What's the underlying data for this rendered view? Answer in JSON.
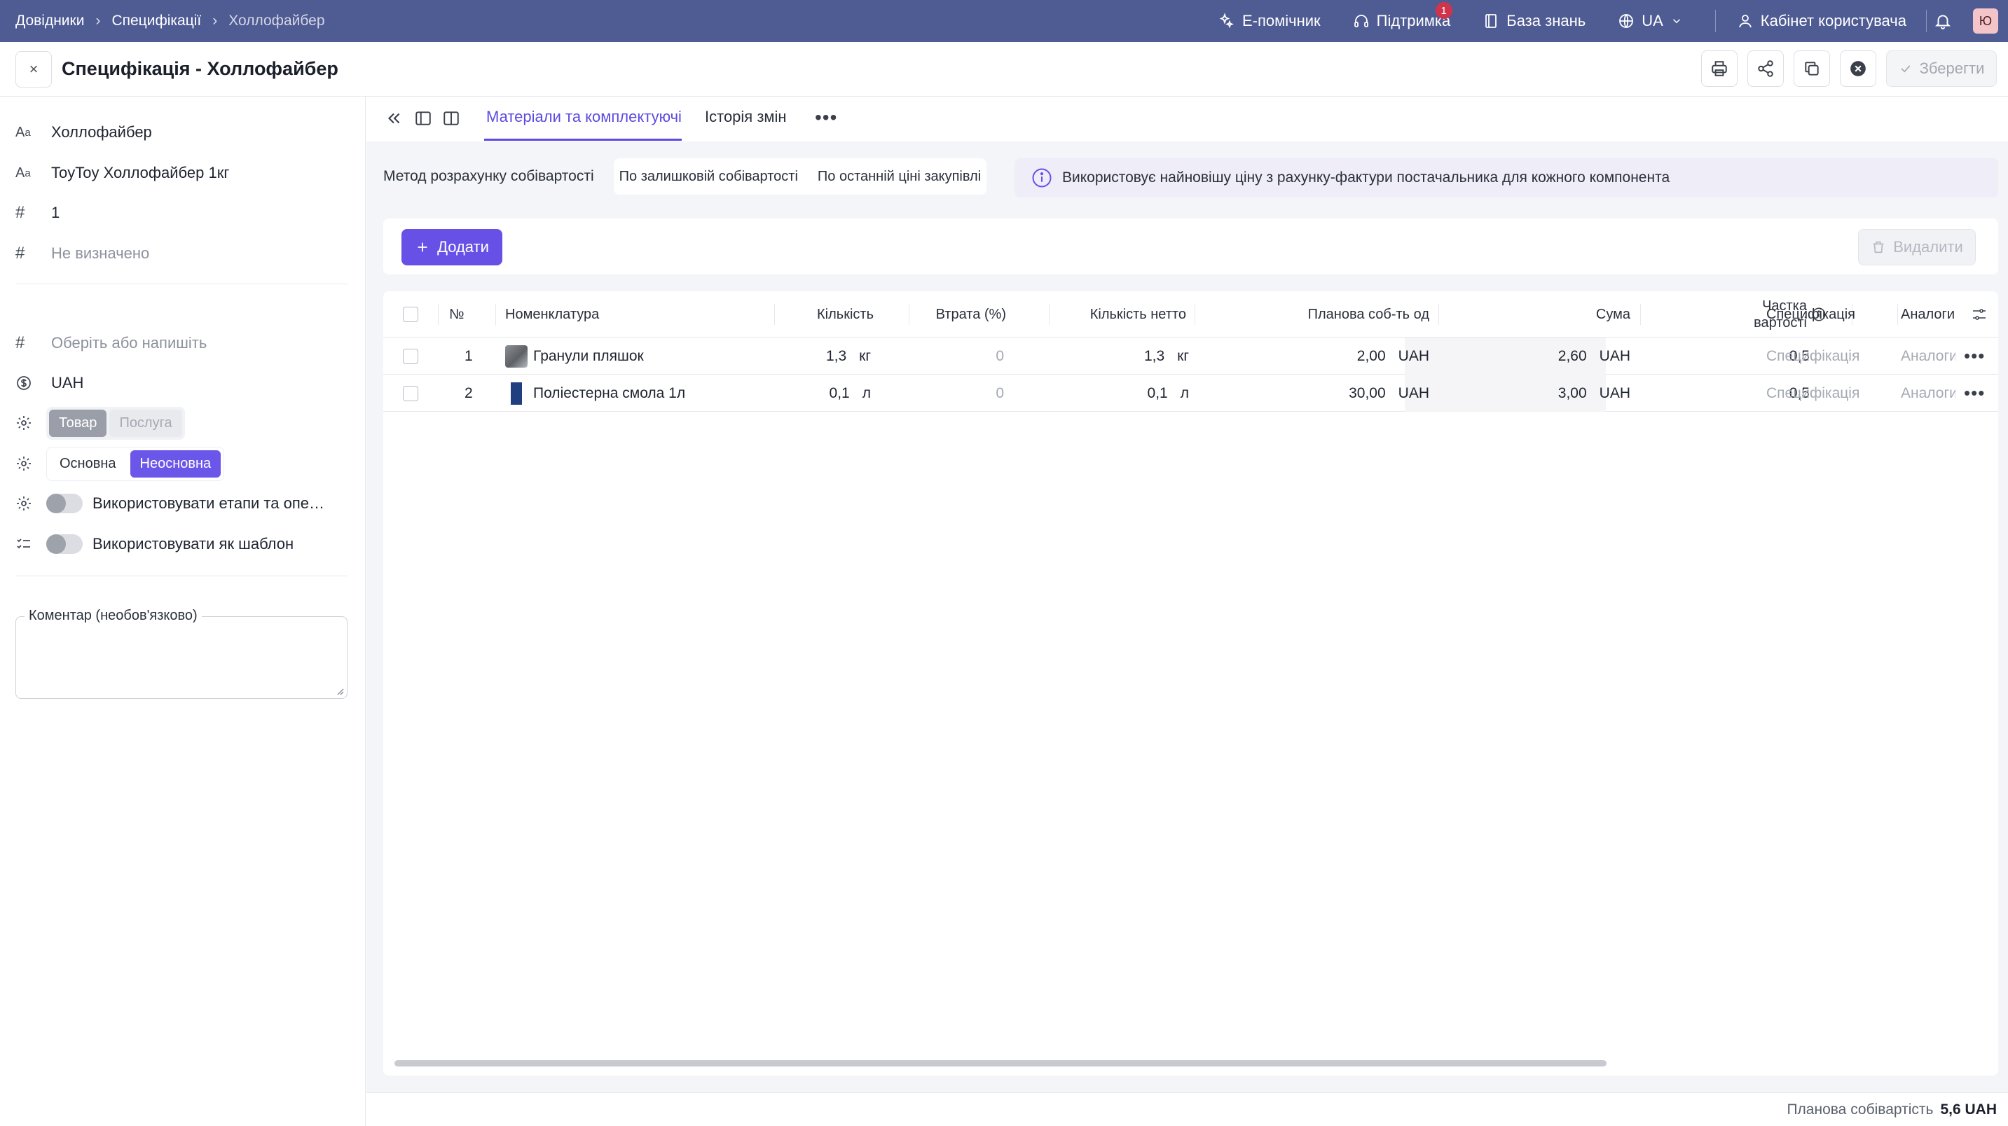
{
  "topbar": {
    "breadcrumbs": [
      "Довідники",
      "Специфікації",
      "Холлофайбер"
    ],
    "links": {
      "assistant": "E-помічник",
      "support": "Підтримка",
      "support_badge": "1",
      "knowledge": "База знань",
      "language": "UA",
      "cabinet": "Кабінет користувача"
    },
    "avatar_initial": "Ю",
    "color": "#4f5b93"
  },
  "titlebar": {
    "close_label": "×",
    "title": "Специфікація - Холлофайбер",
    "save_label": "Зберегти"
  },
  "sidebar": {
    "name": "Холлофайбер",
    "product": "ToyToy Холлофайбер 1кг",
    "quantity": "1",
    "undefined_field": "Не визначено",
    "select_placeholder": "Оберіть або напишіть",
    "currency": "UAH",
    "type_options": [
      "Товар",
      "Послуга"
    ],
    "kind_options": [
      "Основна",
      "Неосновна"
    ],
    "toggle_stages": "Використовувати етапи та операції",
    "toggle_template": "Використовувати як шаблон",
    "comment_label": "Коментар (необов'язково)"
  },
  "tabs": {
    "materials": "Матеріали та комплектуючі",
    "history": "Історія змін",
    "more": "•••"
  },
  "cost_method": {
    "label": "Метод розрахунку собівартості",
    "options": [
      "По залишковій собівартості",
      "По останній ціні закупівлі"
    ],
    "info": "Використовує найновішу ціну з рахунку-фактури постачальника для кожного компонента"
  },
  "actions": {
    "add": "Додати",
    "delete": "Видалити"
  },
  "table": {
    "headers": {
      "num": "№",
      "nomenclature": "Номенклатура",
      "quantity": "Кількість",
      "loss": "Втрата (%)",
      "net": "Кількість нетто",
      "planned_cost": "Планова соб-ть од",
      "sum": "Сума",
      "share_line1": "Частка",
      "share_line2": "вартості",
      "spec": "Специфікація",
      "analogs": "Аналоги"
    },
    "rows": [
      {
        "num": "1",
        "name": "Гранули пляшок",
        "qty": "1,3",
        "qty_unit": "кг",
        "loss": "0",
        "net": "1,3",
        "net_unit": "кг",
        "cost": "2,00",
        "cost_cur": "UAH",
        "sum": "2,60",
        "sum_cur": "UAH",
        "share": "0,5",
        "spec": "Специфікація",
        "analogs": "Аналоги"
      },
      {
        "num": "2",
        "name": "Поліестерна смола 1л",
        "qty": "0,1",
        "qty_unit": "л",
        "loss": "0",
        "net": "0,1",
        "net_unit": "л",
        "cost": "30,00",
        "cost_cur": "UAH",
        "sum": "3,00",
        "sum_cur": "UAH",
        "share": "0,5",
        "spec": "Специфікація",
        "analogs": "Аналоги"
      }
    ]
  },
  "footer": {
    "label": "Планова собівартість",
    "value": "5,6 UAH"
  },
  "colors": {
    "accent": "#6650e6",
    "info_bg": "#eeedf8"
  }
}
